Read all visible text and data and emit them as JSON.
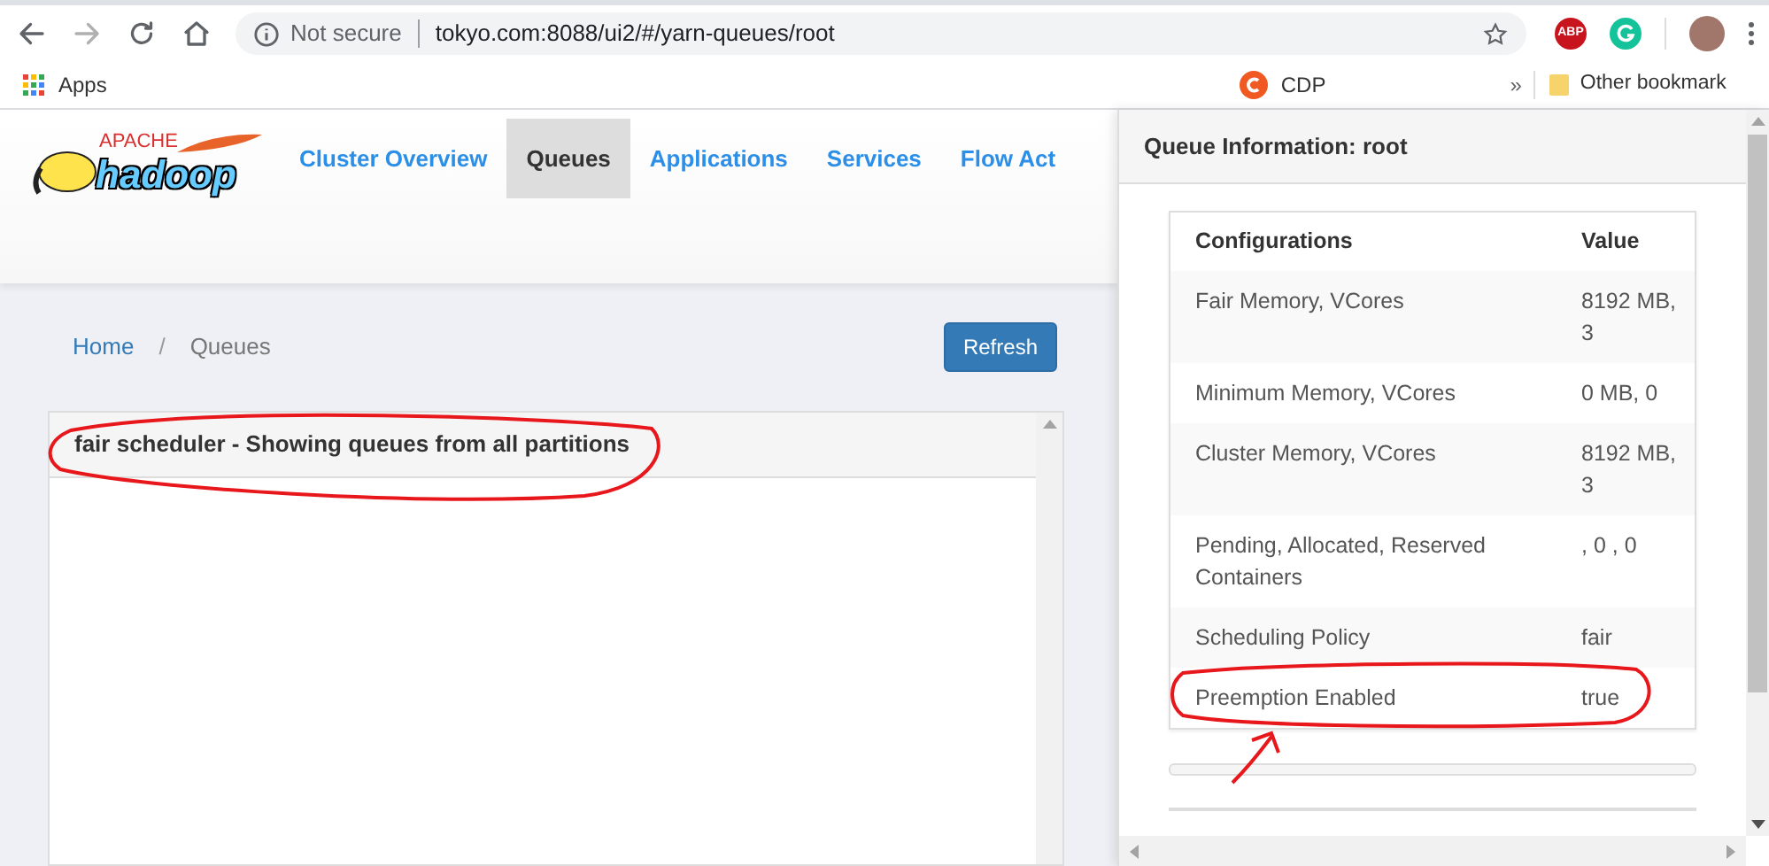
{
  "browser": {
    "nav_buttons": [
      {
        "kind": "back",
        "disabled": false
      },
      {
        "kind": "forward",
        "disabled": true
      },
      {
        "kind": "reload",
        "disabled": false
      },
      {
        "kind": "home",
        "disabled": false
      }
    ],
    "address_bar": {
      "security_label": "Not secure",
      "url": "tokyo.com:8088/ui2/#/yarn-queues/root"
    },
    "extensions": [
      {
        "kind": "abp",
        "label": "ABP"
      },
      {
        "kind": "grammarly"
      }
    ],
    "bookmarks": [
      {
        "kind": "apps",
        "label": "Apps"
      },
      {
        "kind": "site",
        "label": "CDP"
      }
    ],
    "overflow": "»",
    "other_bookmarks": "Other bookmark"
  },
  "logo": {
    "top": "APACHE",
    "word": "hadoop"
  },
  "nav": [
    {
      "label": "Cluster Overview",
      "selected": false
    },
    {
      "label": "Queues",
      "selected": true
    },
    {
      "label": "Applications",
      "selected": false
    },
    {
      "label": "Services",
      "selected": false
    },
    {
      "label": "Flow Act",
      "selected": false
    }
  ],
  "breadcrumb": [
    {
      "label": "Home",
      "current": false
    },
    {
      "label": "Queues",
      "current": true
    }
  ],
  "breadcrumb_separator": "/",
  "refresh_button": "Refresh",
  "queues_panel": {
    "title": "fair scheduler - Showing queues from all partitions"
  },
  "queue_info": {
    "title": "Queue Information: root",
    "columns": [
      "Configurations",
      "Value"
    ],
    "rows": [
      {
        "name": "Fair Memory, VCores",
        "value": "8192 MB, 3"
      },
      {
        "name": "Minimum Memory, VCores",
        "value": "0 MB, 0"
      },
      {
        "name": "Cluster Memory, VCores",
        "value": "8192 MB, 3"
      },
      {
        "name": "Pending, Allocated, Reserved Containers",
        "value": ", 0 , 0"
      },
      {
        "name": "Scheduling Policy",
        "value": "fair"
      },
      {
        "name": "Preemption Enabled",
        "value": "true"
      }
    ]
  }
}
